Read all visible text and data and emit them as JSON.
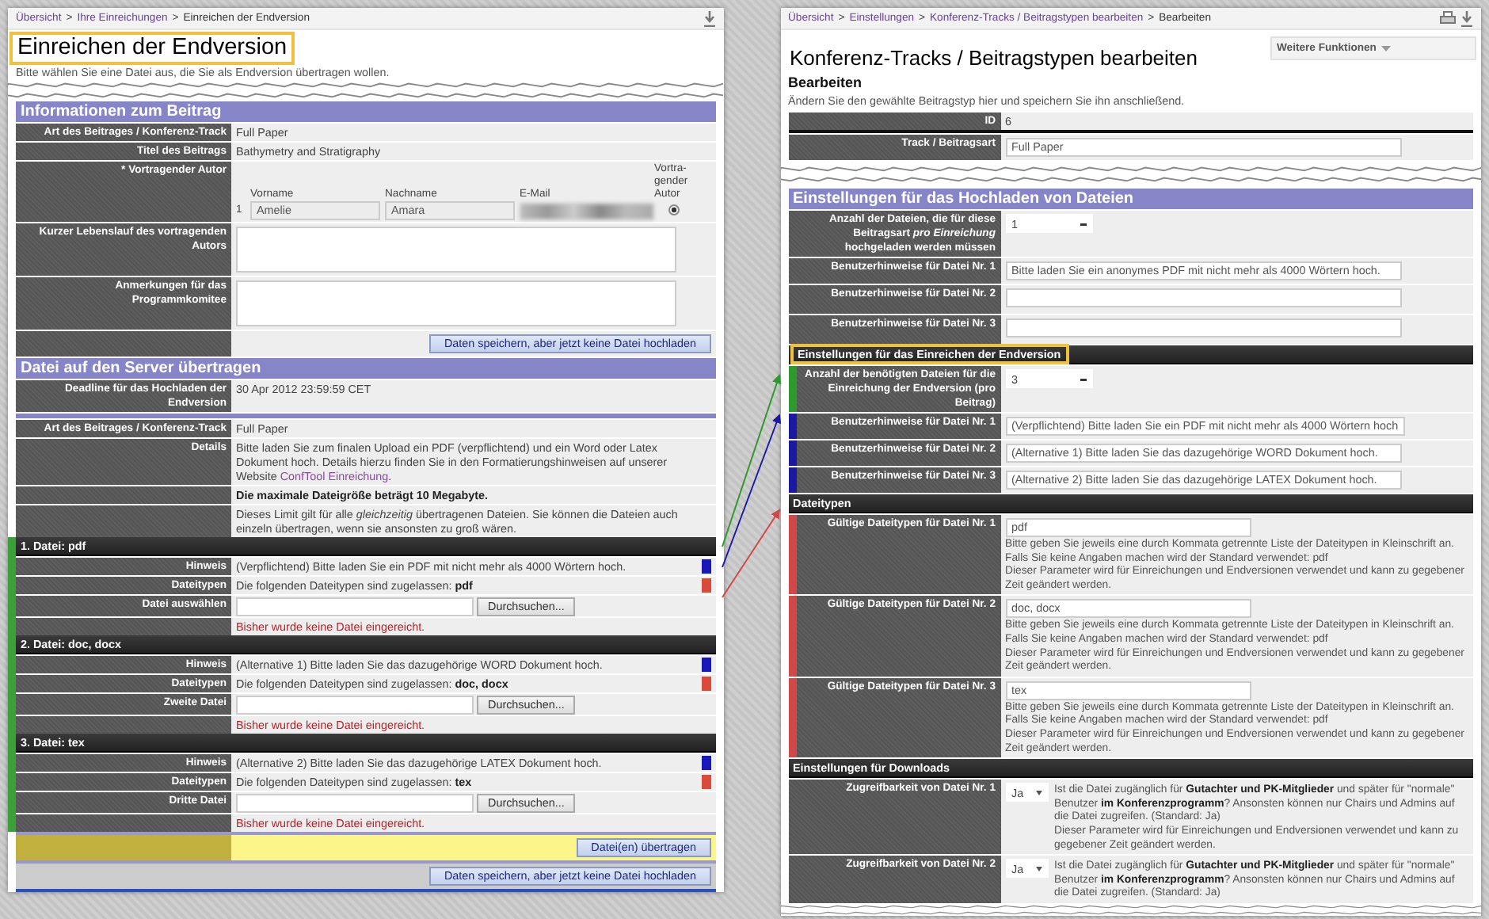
{
  "left": {
    "breadcrumb": {
      "separator": ">",
      "items": [
        {
          "label": "Übersicht",
          "kind": "link"
        },
        {
          "label": "Ihre Einreichungen",
          "kind": "link"
        },
        {
          "label": "Einreichen der Endversion",
          "kind": "current"
        }
      ]
    },
    "title": "Einreichen der Endversion",
    "title_highlighted": true,
    "intro": "Bitte wählen Sie eine Datei aus, die Sie als Endversion übertragen wollen.",
    "info_section": {
      "title": "Informationen zum Beitrag",
      "rows": [
        {
          "label": "Art des Beitrages / Konferenz-Track",
          "value": "Full Paper"
        },
        {
          "label": "Titel des Beitrags",
          "value": "Bathymetry and Stratigraphy"
        }
      ]
    },
    "presenter": {
      "label": "* Vortragender Autor",
      "columns": [
        "Vorname",
        "Nachname",
        "E-Mail",
        "Vortra-gender Autor"
      ],
      "authors": [
        {
          "number": "1",
          "first_name": "Amelie",
          "last_name": "Amara",
          "selected": true
        }
      ]
    },
    "textareas": [
      {
        "label": "Kurzer Lebenslauf des vortragenden Autors"
      },
      {
        "label": "Anmerkungen für das Programmkomitee"
      }
    ],
    "save_button": "Daten speichern, aber jetzt keine Datei hochladen",
    "upload_section": {
      "title": "Datei auf den Server übertragen",
      "deadline": {
        "label": "Deadline für das Hochladen der Endversion",
        "value": "30 Apr 2012 23:59:59 CET"
      },
      "track": {
        "label": "Art des Beitrages / Konferenz-Track",
        "value": "Full Paper"
      },
      "details": {
        "label": "Details",
        "text": "Bitte laden Sie zum finalen Upload ein PDF (verpflichtend) und ein Word oder Latex Dokument hoch. Details hierzu finden Sie in den Formatierungshinweisen auf unserer Website",
        "link": "ConfTool Einreichung",
        "after": "."
      },
      "notes": [
        {
          "text": "Die maximale Dateigröße beträgt 10 Megabyte.",
          "kind": "bold"
        },
        {
          "text": "Dieses Limit gilt für alle *gleichzeitig* übertragenen Dateien. Sie können die Dateien auch einzeln übertragen, wenn sie ansonsten zu groß wären.",
          "kind": "plain"
        }
      ]
    },
    "files": [
      {
        "header": "1. Datei: pdf",
        "hint_label": "Hinweis",
        "hint": "(Verpflichtend) Bitte laden Sie ein PDF mit nicht mehr als 4000 Wörtern hoch.",
        "types_label": "Dateitypen",
        "types": "Die folgenden Dateitypen sind zugelassen: **pdf**",
        "select_label": "Datei auswählen",
        "browse_button": "Durchsuchen...",
        "status": "Bisher wurde keine Datei eingereicht."
      },
      {
        "header": "2. Datei: doc, docx",
        "hint_label": "Hinweis",
        "hint": "(Alternative 1) Bitte laden Sie das dazugehörige WORD Dokument hoch.",
        "types_label": "Dateitypen",
        "types": "Die folgenden Dateitypen sind zugelassen: **doc, docx**",
        "select_label": "Zweite Datei",
        "browse_button": "Durchsuchen...",
        "status": "Bisher wurde keine Datei eingereicht."
      },
      {
        "header": "3. Datei: tex",
        "hint_label": "Hinweis",
        "hint": "(Alternative 2) Bitte laden Sie das dazugehörige LATEX Dokument hoch.",
        "types_label": "Dateitypen",
        "types": "Die folgenden Dateitypen sind zugelassen: **tex**",
        "select_label": "Dritte Datei",
        "browse_button": "Durchsuchen...",
        "status": "Bisher wurde keine Datei eingereicht."
      }
    ],
    "submit_button": "Datei(en) übertragen",
    "save_button_bottom": "Daten speichern, aber jetzt keine Datei hochladen"
  },
  "right": {
    "breadcrumb": {
      "separator": ">",
      "items": [
        {
          "label": "Übersicht",
          "kind": "link"
        },
        {
          "label": "Einstellungen",
          "kind": "link"
        },
        {
          "label": "Konferenz-Tracks / Beitragstypen bearbeiten",
          "kind": "link"
        },
        {
          "label": "Bearbeiten",
          "kind": "current"
        }
      ]
    },
    "menu": "Weitere Funktionen",
    "title": "Konferenz-Tracks / Beitragstypen bearbeiten",
    "subtitle": "Bearbeiten",
    "intro": "Ändern Sie den gewählte Beitragstyp hier und speichern Sie ihn anschließend.",
    "fields": [
      {
        "label": "ID",
        "value": "6",
        "kind": "text"
      },
      {
        "label": "Track / Beitragsart",
        "value": "Full Paper",
        "kind": "input"
      }
    ],
    "sections": [
      {
        "title": "Einstellungen für das Hochladen von Dateien",
        "kind": "banner",
        "highlighted": false,
        "rows": [
          {
            "kind": "select",
            "label": "Anzahl der Dateien, die für diese Beitragsart *pro Einreichung* hochgeladen werden müssen",
            "value": "1"
          },
          {
            "kind": "input",
            "label": "Benutzerhinweise für Datei Nr. 1",
            "value": "Bitte laden Sie ein anonymes PDF mit nicht mehr als 4000 Wörtern hoch."
          },
          {
            "kind": "input",
            "label": "Benutzerhinweise für Datei Nr. 2"
          },
          {
            "kind": "input",
            "label": "Benutzerhinweise für Datei Nr. 3"
          }
        ]
      },
      {
        "title": "Einstellungen für das Einreichen der Endversion",
        "kind": "dark",
        "highlighted": true,
        "rows": [
          {
            "kind": "select",
            "label": "Anzahl der benötigten Dateien für die Einreichung der Endversion (pro Beitrag)",
            "value": "3",
            "color": "#2e9a2e"
          },
          {
            "kind": "input",
            "label": "Benutzerhinweise für Datei Nr. 1",
            "value": "(Verpflichtend) Bitte laden Sie ein PDF mit nicht mehr als 4000 Wörtern hoch",
            "color": "#1a1aa0"
          },
          {
            "kind": "input",
            "label": "Benutzerhinweise für Datei Nr. 2",
            "value": "(Alternative 1) Bitte laden Sie das dazugehörige WORD Dokument hoch.",
            "color": "#1a1aa0"
          },
          {
            "kind": "input",
            "label": "Benutzerhinweise für Datei Nr. 3",
            "value": "(Alternative 2) Bitte laden Sie das dazugehörige LATEX Dokument hoch.",
            "color": "#1a1aa0"
          }
        ]
      },
      {
        "title": "Dateitypen",
        "kind": "dark",
        "highlighted": false,
        "rows": [
          {
            "kind": "filetype",
            "label": "Gültige Dateitypen für Datei Nr. 1",
            "value": "pdf",
            "color": "#d04848",
            "help": [
              "Bitte geben Sie jeweils eine durch Kommata getrennte Liste der Dateitypen in Kleinschrift an.",
              "Falls Sie keine Angaben machen wird der Standard verwendet: pdf",
              "Dieser Parameter wird für Einreichungen und Endversionen verwendet und kann zu gegebener Zeit geändert werden."
            ]
          },
          {
            "kind": "filetype",
            "label": "Gültige Dateitypen für Datei Nr. 2",
            "value": "doc, docx",
            "color": "#d04848",
            "help": [
              "Bitte geben Sie jeweils eine durch Kommata getrennte Liste der Dateitypen in Kleinschrift an.",
              "Falls Sie keine Angaben machen wird der Standard verwendet: pdf",
              "Dieser Parameter wird für Einreichungen und Endversionen verwendet und kann zu gegebener Zeit geändert werden."
            ]
          },
          {
            "kind": "filetype",
            "label": "Gültige Dateitypen für Datei Nr. 3",
            "value": "tex",
            "color": "#d04848",
            "help": [
              "Bitte geben Sie jeweils eine durch Kommata getrennte Liste der Dateitypen in Kleinschrift an.",
              "Falls Sie keine Angaben machen wird der Standard verwendet: pdf",
              "Dieser Parameter wird für Einreichungen und Endversionen verwendet und kann zu gegebener Zeit geändert werden."
            ]
          }
        ]
      },
      {
        "title": "Einstellungen für Downloads",
        "kind": "dark",
        "highlighted": false,
        "rows": [
          {
            "kind": "access",
            "label": "Zugreifbarkeit von Datei Nr. 1",
            "value": "Ja",
            "help": [
              "Ist die Datei zugänglich für **Gutachter und PK-Mitglieder** und später für \"normale\" Benutzer **im Konferenzprogramm**? Ansonsten können nur Chairs und Admins auf die Datei zugreifen. (Standard: Ja)",
              "Dieser Parameter wird für Einreichungen und Endversionen verwendet und kann zu gegebener Zeit geändert werden."
            ]
          },
          {
            "kind": "access",
            "label": "Zugreifbarkeit von Datei Nr. 2",
            "value": "Ja",
            "help": [
              "Ist die Datei zugänglich für **Gutachter und PK-Mitglieder** und später für \"normale\" Benutzer **im Konferenzprogramm**? Ansonsten können nur Chairs und Admins auf die Datei zugreifen. (Standard: Ja)"
            ]
          }
        ]
      }
    ]
  }
}
